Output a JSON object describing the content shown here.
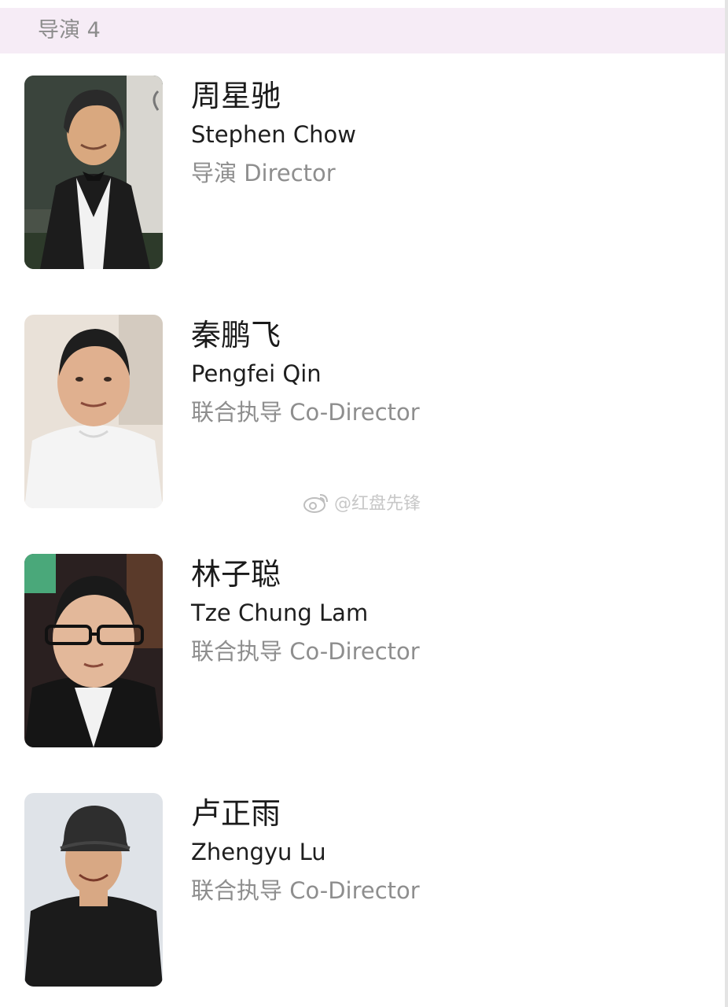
{
  "header": {
    "title": "导演 4"
  },
  "people": [
    {
      "name_zh": "周星驰",
      "name_en": "Stephen Chow",
      "role": "导演 Director",
      "photo_icon": "portrait-photo"
    },
    {
      "name_zh": "秦鹏飞",
      "name_en": "Pengfei Qin",
      "role": "联合执导 Co-Director",
      "photo_icon": "portrait-photo"
    },
    {
      "name_zh": "林子聪",
      "name_en": "Tze Chung Lam",
      "role": "联合执导 Co-Director",
      "photo_icon": "portrait-photo"
    },
    {
      "name_zh": "卢正雨",
      "name_en": "Zhengyu Lu",
      "role": "联合执导 Co-Director",
      "photo_icon": "portrait-photo"
    }
  ],
  "watermark": {
    "text": "@红盘先锋",
    "icon": "weibo-icon"
  }
}
